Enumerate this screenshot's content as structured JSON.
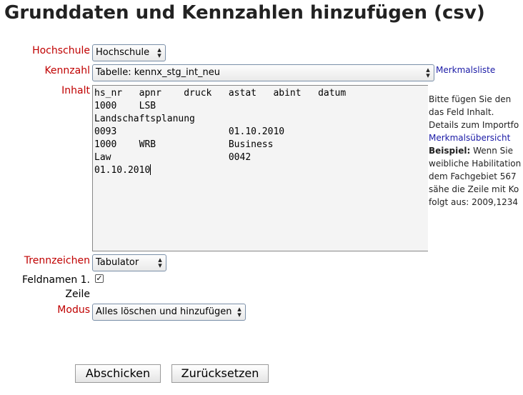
{
  "page": {
    "title": "Grunddaten und Kennzahlen hinzufügen (csv)"
  },
  "form": {
    "hochschule": {
      "label": "Hochschule",
      "value": "Hochschule"
    },
    "kennzahl": {
      "label": "Kennzahl",
      "value": "Tabelle: kennx_stg_int_neu",
      "link": "Merkmalsliste"
    },
    "inhalt": {
      "label": "Inhalt",
      "lines": [
        "hs_nr   apnr    druck   astat   abint   datum",
        "1000    LSB",
        "Landschaftsplanung",
        "0093                    01.10.2010",
        "1000    WRB             Business",
        "Law                     0042",
        "01.10.2010"
      ]
    },
    "trennzeichen": {
      "label": "Trennzeichen",
      "value": "Tabulator"
    },
    "feldnamen": {
      "label_line1": "Feldnamen 1.",
      "label_line2": "Zeile",
      "checked": true,
      "check_glyph": "✓"
    },
    "modus": {
      "label": "Modus",
      "value": "Alles löschen und hinzufügen"
    }
  },
  "help": {
    "line1": "Bitte fügen Sie den",
    "line2": "das Feld Inhalt.",
    "line3": "Details zum Importfo",
    "link": "Merkmalsübersicht",
    "example_label": "Beispiel:",
    "example_rest": " Wenn Sie",
    "line5": "weibliche Habilitation",
    "line6": "dem Fachgebiet 567",
    "line7": "sähe die Zeile mit Ko",
    "line8": "folgt aus: 2009,1234"
  },
  "buttons": {
    "submit": "Abschicken",
    "reset": "Zurücksetzen"
  },
  "colors": {
    "label_red": "#c00000",
    "link_blue": "#1a1aa6",
    "textarea_bg": "#f4f4f4"
  },
  "icons": {
    "select_arrow": "⇕"
  }
}
